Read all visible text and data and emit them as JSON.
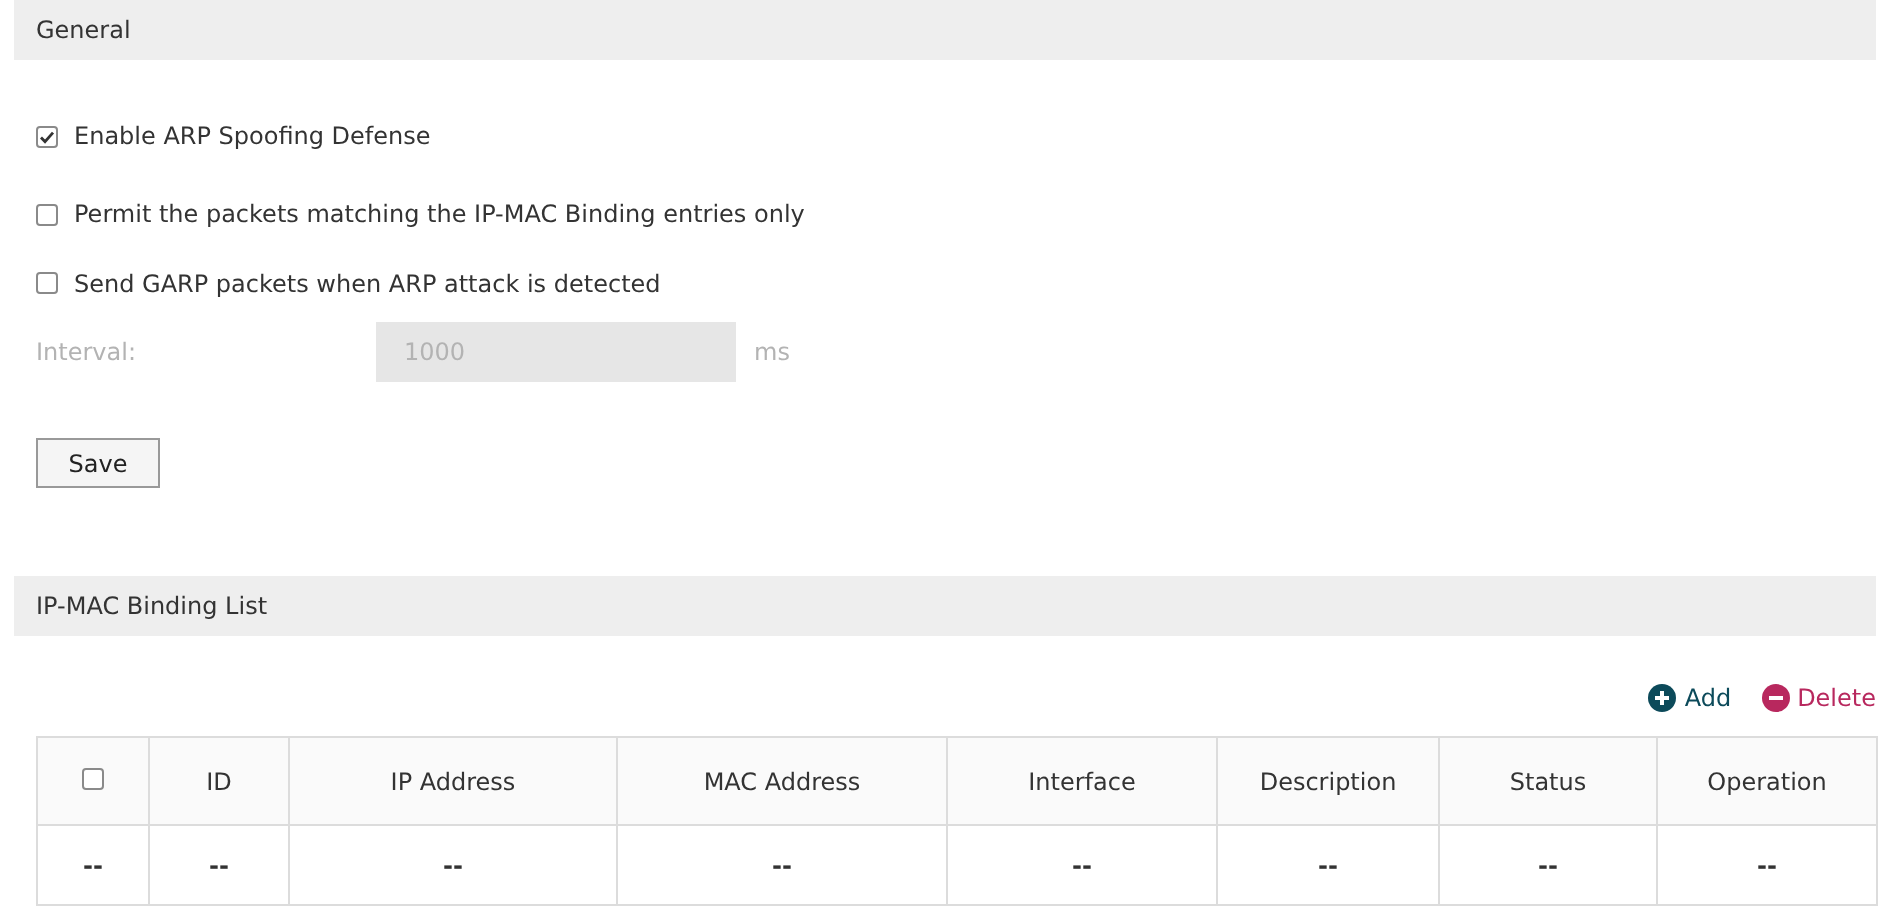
{
  "general": {
    "title": "General",
    "options": [
      {
        "label": "Enable ARP Spoofing Defense",
        "checked": true
      },
      {
        "label": "Permit the packets matching the IP-MAC Binding entries only",
        "checked": false
      },
      {
        "label": "Send GARP packets when ARP attack is detected",
        "checked": false
      }
    ],
    "interval": {
      "label": "Interval:",
      "value": "1000",
      "unit": "ms",
      "disabled": true
    },
    "save_button": "Save"
  },
  "binding_list": {
    "title": "IP-MAC Binding List",
    "actions": [
      {
        "kind": "add",
        "label": "Add"
      },
      {
        "kind": "delete",
        "label": "Delete"
      }
    ],
    "table": {
      "columns": [
        {
          "kind": "checkbox",
          "checked": false
        },
        {
          "kind": "text",
          "label": "ID"
        },
        {
          "kind": "text",
          "label": "IP Address"
        },
        {
          "kind": "text",
          "label": "MAC Address"
        },
        {
          "kind": "text",
          "label": "Interface"
        },
        {
          "kind": "text",
          "label": "Description"
        },
        {
          "kind": "text",
          "label": "Status"
        },
        {
          "kind": "text",
          "label": "Operation"
        }
      ],
      "rows": [
        [
          "--",
          "--",
          "--",
          "--",
          "--",
          "--",
          "--",
          "--"
        ]
      ]
    }
  }
}
